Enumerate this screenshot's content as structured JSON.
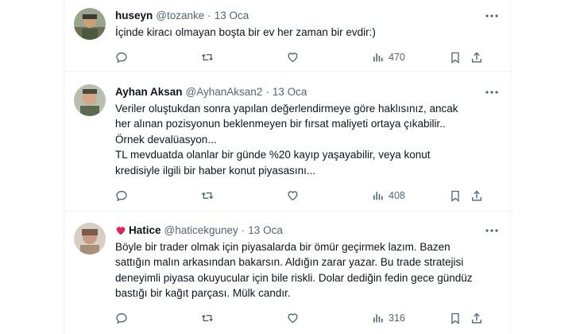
{
  "tweets": [
    {
      "name": "huseyn",
      "handle": "@tozanke",
      "separator": "·",
      "date": "13 Oca",
      "lines": [
        "İçinde kiracı olmayan boşta bir ev her zaman bir evdir:)"
      ],
      "views": "470",
      "avatar": "avatar-photo"
    },
    {
      "name": "Ayhan Aksan",
      "handle": "@AyhanAksan2",
      "separator": "·",
      "date": "13 Oca",
      "lines": [
        "Veriler oluştukdan sonra yapılan değerlendirmeye göre haklısınız, ancak",
        "her alınan pozisyonun beklenmeyen bir fırsat maliyeti ortaya çıkabilir..",
        "Örnek devalüasyon...",
        "TL mevduatda olanlar bir günde %20 kayıp yaşayabilir, veya konut",
        "kredisiyle ilgili bir haber konut piyasasını..."
      ],
      "views": "408",
      "avatar": "avatar-photo"
    },
    {
      "name": "Hatice",
      "handle": "@haticekguney",
      "separator": "·",
      "date": "13 Oca",
      "name_emoji": "red-heart-icon",
      "lines": [
        "Böyle bir trader olmak için piyasalarda bir ömür geçirmek lazım. Bazen",
        "sattığın malın arkasından bakarsın. Aldığın zarar yazar. Bu trade stratejisi",
        "deneyimli piyasa okuyucular için bile riskli. Dolar dediğin fedin gece gündüz",
        "bastığı bir kağıt parçası. Mülk candır."
      ],
      "views": "316",
      "avatar": "avatar-photo"
    }
  ],
  "icons": {
    "more": "more-icon",
    "reply": "reply-icon",
    "retweet": "retweet-icon",
    "like": "like-icon",
    "views": "views-icon",
    "bookmark": "bookmark-icon",
    "share": "share-icon"
  },
  "colors": {
    "text": "#0f1419",
    "secondary": "#536471",
    "border": "#eff3f4",
    "heart": "#e0245e"
  }
}
